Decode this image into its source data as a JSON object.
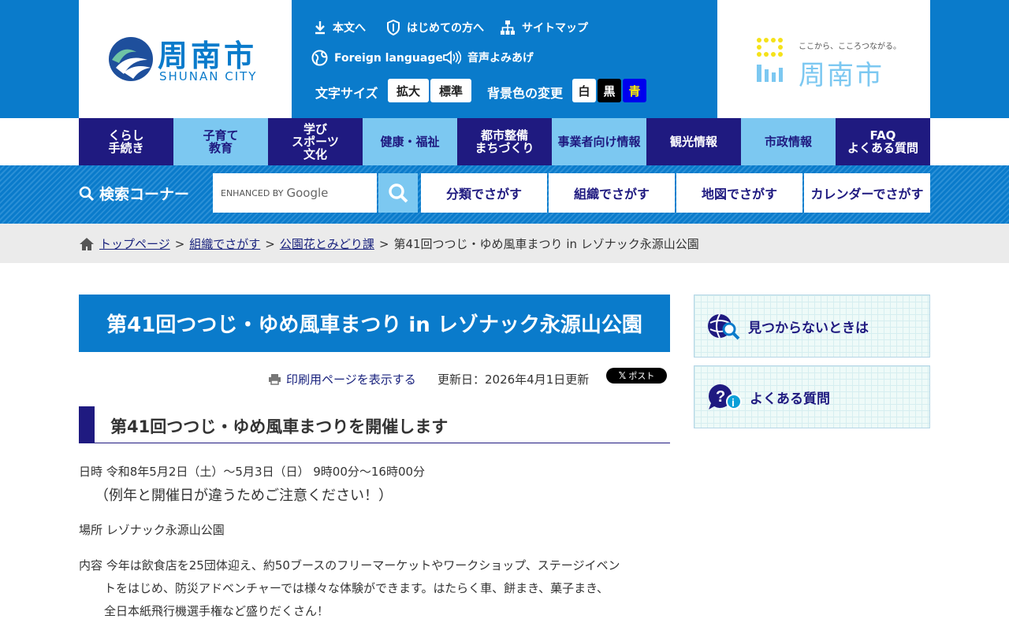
{
  "header": {
    "logo_main": "周南市",
    "logo_sub": "SHUNAN CITY",
    "logo_right_tagline": "ここから、こころつながる。",
    "logo_right_name": "周南市",
    "util_links": {
      "skip": "本文へ",
      "first_time": "はじめての方へ",
      "sitemap": "サイトマップ",
      "foreign": "Foreign language",
      "voice": "音声よみあげ"
    },
    "font_size_label": "文字サイズ",
    "font_size_large": "拡大",
    "font_size_normal": "標準",
    "bg_color_label": "背景色の変更",
    "bg_white": "白",
    "bg_black": "黒",
    "bg_blue": "青"
  },
  "global_nav": [
    {
      "label": "くらし\n手続き"
    },
    {
      "label": "子育て\n教育"
    },
    {
      "label": "学び\nスポーツ\n文化"
    },
    {
      "label": "健康・福祉"
    },
    {
      "label": "都市整備\nまちづくり"
    },
    {
      "label": "事業者向け情報"
    },
    {
      "label": "観光情報"
    },
    {
      "label": "市政情報"
    },
    {
      "label": "FAQ\nよくある質問"
    }
  ],
  "search": {
    "title": "検索コーナー",
    "enhanced_by": "ENHANCED BY",
    "google": "Google",
    "buttons": [
      "分類でさがす",
      "組織でさがす",
      "地図でさがす",
      "カレンダーでさがす"
    ]
  },
  "breadcrumb": {
    "top": "トップページ",
    "org": "組織でさがす",
    "dept": "公園花とみどり課",
    "current": "第41回つつじ・ゆめ風車まつり in レゾナック永源山公園",
    "sep": ">"
  },
  "article": {
    "title": "第41回つつじ・ゆめ風車まつり in レゾナック永源山公園",
    "print_link": "印刷用ページを表示する",
    "updated": "更新日：2026年4月1日更新",
    "x_post": "ポスト",
    "heading": "第41回つつじ・ゆめ風車まつりを開催します",
    "date_line": "日時 令和8年5月2日（土）～5月3日（日） 9時00分～16時00分",
    "date_note": "（例年と開催日が違うためご注意ください！）",
    "place_line": "場所 レゾナック永源山公園",
    "content_line1": "内容 今年は飲食店を25団体迎え、約50ブースのフリーマーケットやワークショップ、ステージイベン",
    "content_line2": "トをはじめ、防災アドベンチャーでは様々な体験ができます。はたらく車、餅まき、菓子まき、",
    "content_line3": "全日本紙飛行機選手権など盛りだくさん！"
  },
  "sidebar": {
    "not_found": "見つからないときは",
    "faq": "よくある質問"
  },
  "colors": {
    "primary_blue": "#0a7bcb",
    "navy": "#1f1a80",
    "light_blue": "#7cc8f1"
  }
}
